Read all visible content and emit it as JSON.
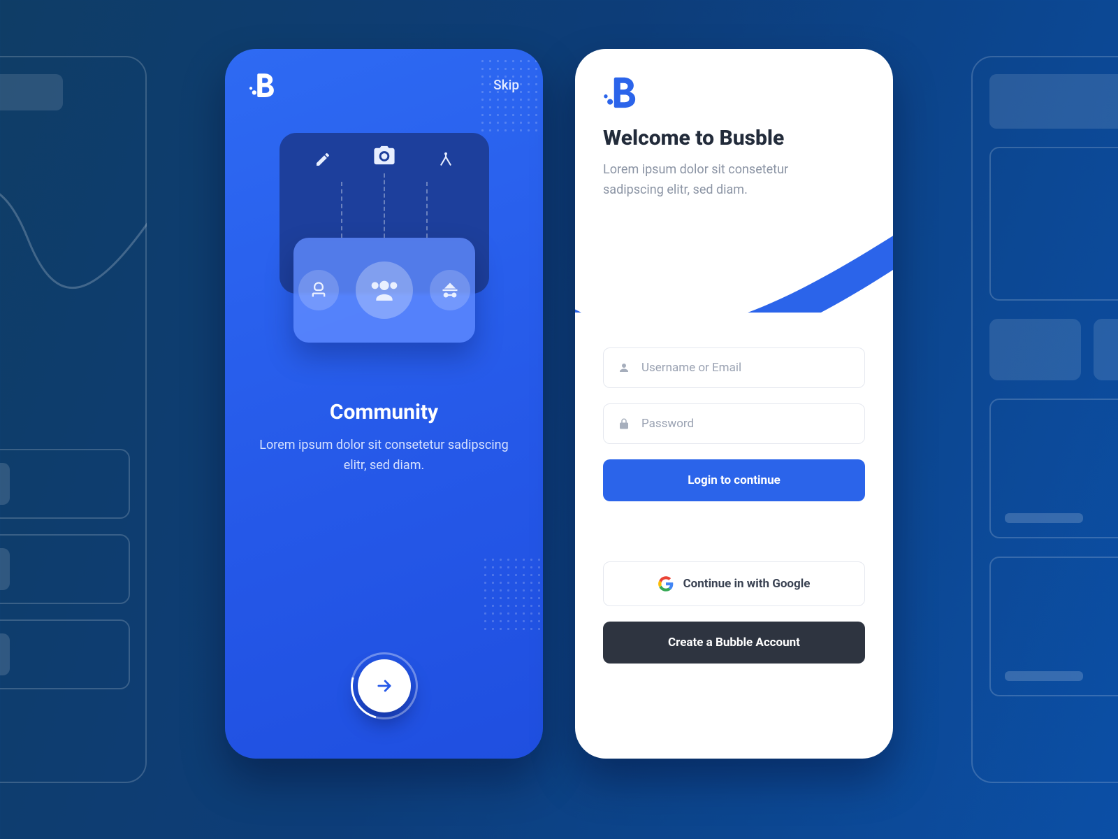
{
  "brand": {
    "name": "Busble"
  },
  "onboarding": {
    "skip_label": "Skip",
    "title": "Community",
    "description": "Lorem ipsum dolor sit consetetur sadipscing elitr, sed diam.",
    "illustration_icons": [
      "pencil-icon",
      "camera-icon",
      "compass-icon"
    ],
    "people_icons": [
      "astronaut-icon",
      "group-icon",
      "spy-icon"
    ],
    "next_aria": "Next"
  },
  "login": {
    "welcome_title": "Welcome to Busble",
    "welcome_subtitle": "Lorem ipsum dolor sit consetetur sadipscing elitr, sed diam.",
    "username_placeholder": "Username or Email",
    "password_placeholder": "Password",
    "login_button": "Login to continue",
    "google_button": "Continue in with Google",
    "create_button": "Create a Bubble Account"
  },
  "colors": {
    "accent": "#2b64ea",
    "dark": "#2e3440",
    "bg_gradient_from": "#0f3d66",
    "bg_gradient_to": "#0b4fa6"
  }
}
